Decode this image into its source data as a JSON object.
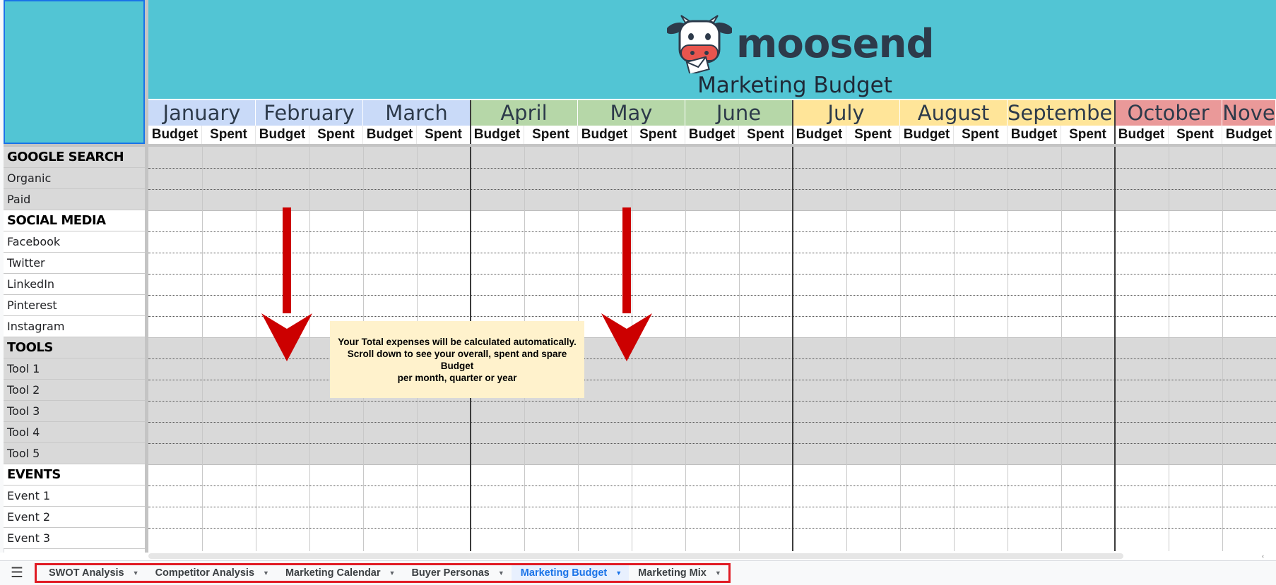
{
  "header": {
    "logo_text": "moosend",
    "title": "Marketing Budget"
  },
  "months": [
    {
      "name": "January",
      "color": "#c9daf8"
    },
    {
      "name": "February",
      "color": "#c9daf8"
    },
    {
      "name": "March",
      "color": "#c9daf8"
    },
    {
      "name": "April",
      "color": "#b6d7a8"
    },
    {
      "name": "May",
      "color": "#b6d7a8"
    },
    {
      "name": "June",
      "color": "#b6d7a8"
    },
    {
      "name": "July",
      "color": "#ffe599"
    },
    {
      "name": "August",
      "color": "#ffe599"
    },
    {
      "name": "September",
      "color": "#ffe599"
    },
    {
      "name": "October",
      "color": "#ea9999"
    },
    {
      "name": "Nove",
      "color": "#ea9999"
    }
  ],
  "subheaders": {
    "budget": "Budget",
    "spent": "Spent"
  },
  "rows": [
    {
      "label": "GOOGLE SEARCH",
      "category": true,
      "shade": "gray"
    },
    {
      "label": "Organic",
      "category": false,
      "shade": "gray"
    },
    {
      "label": "Paid",
      "category": false,
      "shade": "gray"
    },
    {
      "label": "SOCIAL MEDIA",
      "category": true,
      "shade": "white"
    },
    {
      "label": "Facebook",
      "category": false,
      "shade": "white"
    },
    {
      "label": "Twitter",
      "category": false,
      "shade": "white"
    },
    {
      "label": "LinkedIn",
      "category": false,
      "shade": "white"
    },
    {
      "label": "Pinterest",
      "category": false,
      "shade": "white"
    },
    {
      "label": "Instagram",
      "category": false,
      "shade": "white"
    },
    {
      "label": "TOOLS",
      "category": true,
      "shade": "gray"
    },
    {
      "label": "Tool 1",
      "category": false,
      "shade": "gray"
    },
    {
      "label": "Tool 2",
      "category": false,
      "shade": "gray"
    },
    {
      "label": "Tool 3",
      "category": false,
      "shade": "gray"
    },
    {
      "label": "Tool 4",
      "category": false,
      "shade": "gray"
    },
    {
      "label": "Tool 5",
      "category": false,
      "shade": "gray"
    },
    {
      "label": "EVENTS",
      "category": true,
      "shade": "white"
    },
    {
      "label": "Event 1",
      "category": false,
      "shade": "white"
    },
    {
      "label": "Event 2",
      "category": false,
      "shade": "white"
    },
    {
      "label": "Event 3",
      "category": false,
      "shade": "white"
    }
  ],
  "note": {
    "line1": "Your Total expenses will be calculated automatically.",
    "line2": "Scroll down to see your overall, spent and spare Budget",
    "line3": "per month, quarter or year"
  },
  "colors": {
    "banner": "#52c5d4",
    "gray_band": "#d9d9d9",
    "arrow": "#cc0000",
    "note_bg": "#fff2cc"
  },
  "tabs": [
    {
      "label": "SWOT Analysis",
      "active": false
    },
    {
      "label": "Competitor Analysis",
      "active": false
    },
    {
      "label": "Marketing Calendar",
      "active": false
    },
    {
      "label": "Buyer Personas",
      "active": false
    },
    {
      "label": "Marketing Budget",
      "active": true
    },
    {
      "label": "Marketing Mix",
      "active": false
    }
  ]
}
